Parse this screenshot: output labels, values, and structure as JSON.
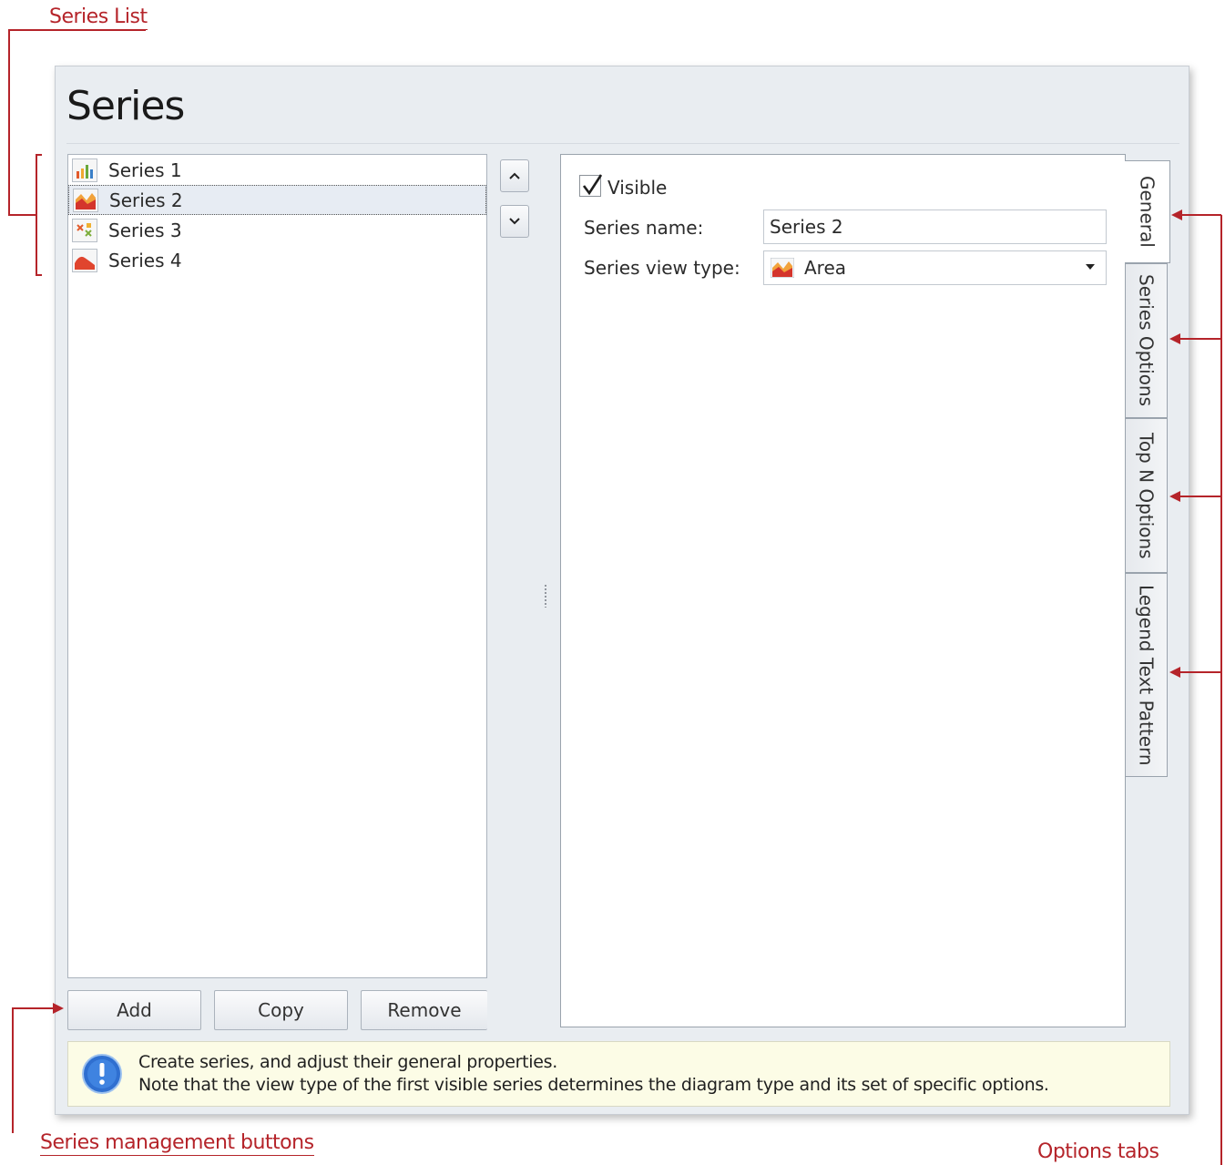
{
  "annotations": {
    "series_list": "Series List",
    "series_management_buttons": "Series management buttons",
    "options_tabs": "Options tabs",
    "color": "#b5242a"
  },
  "dialog": {
    "title": "Series"
  },
  "series_list": {
    "items": [
      {
        "label": "Series 1",
        "icon": "bar-chart-icon"
      },
      {
        "label": "Series 2",
        "icon": "area-chart-icon",
        "selected": true
      },
      {
        "label": "Series 3",
        "icon": "point-chart-icon"
      },
      {
        "label": "Series 4",
        "icon": "spline-area-chart-icon"
      }
    ]
  },
  "move_buttons": {
    "up_icon": "chevron-up-icon",
    "down_icon": "chevron-down-icon"
  },
  "management_buttons": {
    "add": "Add",
    "copy": "Copy",
    "remove": "Remove"
  },
  "general": {
    "visible_label": "Visible",
    "visible_checked": true,
    "series_name_label": "Series name:",
    "series_name_value": "Series 2",
    "view_type_label": "Series view type:",
    "view_type_value": "Area"
  },
  "tabs": [
    "General",
    "Series Options",
    "Top N Options",
    "Legend Text Pattern"
  ],
  "info": {
    "line1": "Create series, and adjust their general properties.",
    "line2": "Note that the view type of the first visible series determines the diagram type and its set of specific options."
  }
}
